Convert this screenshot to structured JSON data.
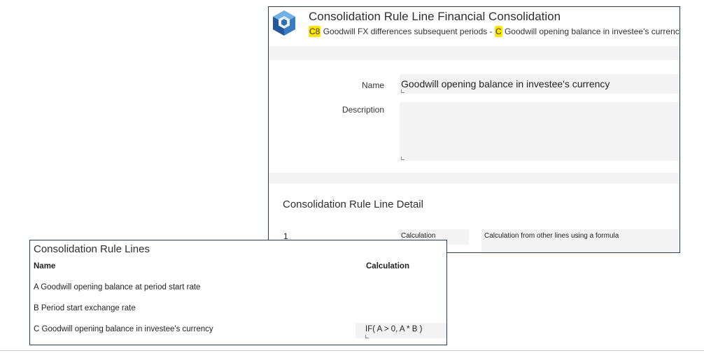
{
  "record": {
    "title": "Consolidation Rule Line Financial Consolidation",
    "subtitle": {
      "code1": "C8",
      "text1": "Goodwill FX differences subsequent periods -",
      "code2": "C",
      "text2": "Goodwill opening balance in investee's currency"
    },
    "fields": {
      "name_label": "Name",
      "name_value": "Goodwill opening balance in investee's currency",
      "description_label": "Description",
      "description_value": ""
    },
    "detail": {
      "heading": "Consolidation Rule Line Detail",
      "row": {
        "number": "1",
        "type": "Calculation",
        "description": "Calculation from other lines using a formula"
      }
    },
    "colors": {
      "highlight": "#ffe500",
      "border": "#2b3a55",
      "field_bg": "#f3f3f3"
    }
  },
  "rule_lines": {
    "title": "Consolidation Rule Lines",
    "columns": [
      "Name",
      "Calculation"
    ],
    "rows": [
      {
        "name": "A Goodwill opening balance at period start rate",
        "calculation": ""
      },
      {
        "name": "B Period start exchange rate",
        "calculation": ""
      },
      {
        "name": "C Goodwill opening balance in investee's currency",
        "calculation": "IF( A > 0, A * B )"
      }
    ]
  },
  "icons": {
    "logo": "cube-logo-icon",
    "resize": "resize-corner-icon"
  }
}
